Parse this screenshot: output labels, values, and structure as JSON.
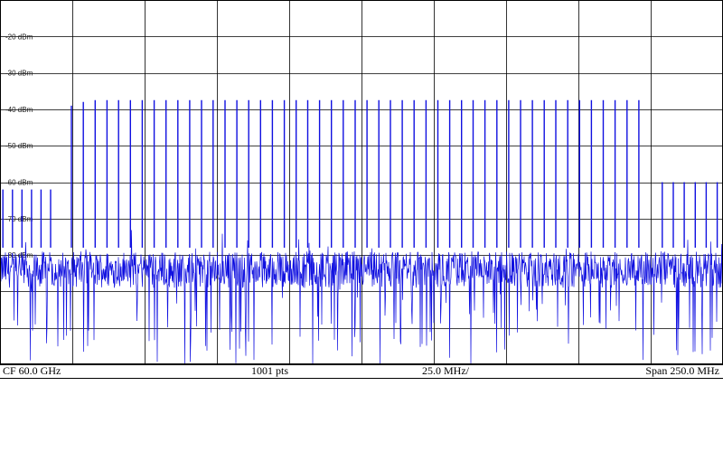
{
  "chart_data": {
    "type": "line",
    "title": "",
    "xlabel": "",
    "ylabel": "",
    "y_unit": "dBm",
    "y_ticks": [
      -20,
      -30,
      -40,
      -50,
      -60,
      -70,
      -80
    ],
    "y_tick_labels": [
      "-20 dBm",
      "-30 dBm",
      "-40 dBm",
      "-50 dBm",
      "-60 dBm",
      "-70 dBm",
      "-80 dBm"
    ],
    "ylim": [
      -110,
      -10
    ],
    "xlim": [
      -125.0,
      125.0
    ],
    "x_unit": "MHz offset from CF",
    "grid": true,
    "noise_floor_dbm": -82,
    "series": [
      {
        "values_note": "",
        "tones": [
          {
            "x": -124.0,
            "y": -62
          },
          {
            "x": -120.7,
            "y": -62
          },
          {
            "x": -117.4,
            "y": -62
          },
          {
            "x": -114.1,
            "y": -62
          },
          {
            "x": -110.8,
            "y": -62
          },
          {
            "x": -107.5,
            "y": -62
          },
          {
            "x": -100.3,
            "y": -39
          },
          {
            "x": -96.2,
            "y": -38
          },
          {
            "x": -92.1,
            "y": -37.5
          },
          {
            "x": -88.0,
            "y": -37.5
          },
          {
            "x": -84.0,
            "y": -37.5
          },
          {
            "x": -79.9,
            "y": -37.5
          },
          {
            "x": -75.8,
            "y": -37.5
          },
          {
            "x": -71.7,
            "y": -37.5
          },
          {
            "x": -67.6,
            "y": -37.5
          },
          {
            "x": -63.5,
            "y": -37.5
          },
          {
            "x": -59.4,
            "y": -37.5
          },
          {
            "x": -55.3,
            "y": -37.5
          },
          {
            "x": -51.3,
            "y": -37.5
          },
          {
            "x": -47.2,
            "y": -37.5
          },
          {
            "x": -43.1,
            "y": -37.5
          },
          {
            "x": -39.0,
            "y": -37.5
          },
          {
            "x": -34.9,
            "y": -37.5
          },
          {
            "x": -30.8,
            "y": -37.5
          },
          {
            "x": -26.7,
            "y": -37.5
          },
          {
            "x": -22.6,
            "y": -37.5
          },
          {
            "x": -18.6,
            "y": -37.5
          },
          {
            "x": -14.5,
            "y": -37.5
          },
          {
            "x": -10.4,
            "y": -37.5
          },
          {
            "x": -6.3,
            "y": -37.5
          },
          {
            "x": -2.2,
            "y": -37.5
          },
          {
            "x": 1.9,
            "y": -37.5
          },
          {
            "x": 6.0,
            "y": -37.5
          },
          {
            "x": 10.0,
            "y": -37.5
          },
          {
            "x": 14.1,
            "y": -37.5
          },
          {
            "x": 18.2,
            "y": -37.5
          },
          {
            "x": 22.3,
            "y": -37.5
          },
          {
            "x": 26.4,
            "y": -37.5
          },
          {
            "x": 30.5,
            "y": -37.5
          },
          {
            "x": 34.6,
            "y": -37.5
          },
          {
            "x": 38.6,
            "y": -37.5
          },
          {
            "x": 42.7,
            "y": -37.5
          },
          {
            "x": 46.8,
            "y": -37.5
          },
          {
            "x": 50.9,
            "y": -37.5
          },
          {
            "x": 55.0,
            "y": -37.5
          },
          {
            "x": 59.1,
            "y": -37.5
          },
          {
            "x": 63.2,
            "y": -37.5
          },
          {
            "x": 67.2,
            "y": -37.5
          },
          {
            "x": 71.3,
            "y": -37.5
          },
          {
            "x": 75.4,
            "y": -37.5
          },
          {
            "x": 79.5,
            "y": -37.5
          },
          {
            "x": 83.6,
            "y": -37.5
          },
          {
            "x": 87.7,
            "y": -37.5
          },
          {
            "x": 91.8,
            "y": -37.5
          },
          {
            "x": 95.9,
            "y": -37.5
          },
          {
            "x": 104.0,
            "y": -60
          },
          {
            "x": 107.8,
            "y": -60
          },
          {
            "x": 111.6,
            "y": -60
          },
          {
            "x": 115.4,
            "y": -60
          },
          {
            "x": 119.2,
            "y": -60
          },
          {
            "x": 123.0,
            "y": -60
          }
        ]
      }
    ]
  },
  "annotations": {
    "cf": "CF 60.0 GHz",
    "points": "1001 pts",
    "per_div": "25.0 MHz/",
    "span": "Span 250.0 MHz"
  },
  "colors": {
    "trace": "#1010e0",
    "grid": "#000000",
    "background": "#ffffff"
  }
}
